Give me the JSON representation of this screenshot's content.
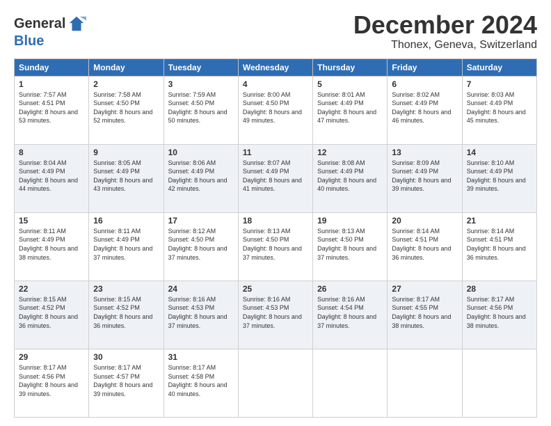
{
  "logo": {
    "line1": "General",
    "line2": "Blue"
  },
  "title": "December 2024",
  "subtitle": "Thonex, Geneva, Switzerland",
  "days_header": [
    "Sunday",
    "Monday",
    "Tuesday",
    "Wednesday",
    "Thursday",
    "Friday",
    "Saturday"
  ],
  "weeks": [
    [
      {
        "day": "1",
        "sunrise": "7:57 AM",
        "sunset": "4:51 PM",
        "daylight": "8 hours and 53 minutes."
      },
      {
        "day": "2",
        "sunrise": "7:58 AM",
        "sunset": "4:50 PM",
        "daylight": "8 hours and 52 minutes."
      },
      {
        "day": "3",
        "sunrise": "7:59 AM",
        "sunset": "4:50 PM",
        "daylight": "8 hours and 50 minutes."
      },
      {
        "day": "4",
        "sunrise": "8:00 AM",
        "sunset": "4:50 PM",
        "daylight": "8 hours and 49 minutes."
      },
      {
        "day": "5",
        "sunrise": "8:01 AM",
        "sunset": "4:49 PM",
        "daylight": "8 hours and 47 minutes."
      },
      {
        "day": "6",
        "sunrise": "8:02 AM",
        "sunset": "4:49 PM",
        "daylight": "8 hours and 46 minutes."
      },
      {
        "day": "7",
        "sunrise": "8:03 AM",
        "sunset": "4:49 PM",
        "daylight": "8 hours and 45 minutes."
      }
    ],
    [
      {
        "day": "8",
        "sunrise": "8:04 AM",
        "sunset": "4:49 PM",
        "daylight": "8 hours and 44 minutes."
      },
      {
        "day": "9",
        "sunrise": "8:05 AM",
        "sunset": "4:49 PM",
        "daylight": "8 hours and 43 minutes."
      },
      {
        "day": "10",
        "sunrise": "8:06 AM",
        "sunset": "4:49 PM",
        "daylight": "8 hours and 42 minutes."
      },
      {
        "day": "11",
        "sunrise": "8:07 AM",
        "sunset": "4:49 PM",
        "daylight": "8 hours and 41 minutes."
      },
      {
        "day": "12",
        "sunrise": "8:08 AM",
        "sunset": "4:49 PM",
        "daylight": "8 hours and 40 minutes."
      },
      {
        "day": "13",
        "sunrise": "8:09 AM",
        "sunset": "4:49 PM",
        "daylight": "8 hours and 39 minutes."
      },
      {
        "day": "14",
        "sunrise": "8:10 AM",
        "sunset": "4:49 PM",
        "daylight": "8 hours and 39 minutes."
      }
    ],
    [
      {
        "day": "15",
        "sunrise": "8:11 AM",
        "sunset": "4:49 PM",
        "daylight": "8 hours and 38 minutes."
      },
      {
        "day": "16",
        "sunrise": "8:11 AM",
        "sunset": "4:49 PM",
        "daylight": "8 hours and 37 minutes."
      },
      {
        "day": "17",
        "sunrise": "8:12 AM",
        "sunset": "4:50 PM",
        "daylight": "8 hours and 37 minutes."
      },
      {
        "day": "18",
        "sunrise": "8:13 AM",
        "sunset": "4:50 PM",
        "daylight": "8 hours and 37 minutes."
      },
      {
        "day": "19",
        "sunrise": "8:13 AM",
        "sunset": "4:50 PM",
        "daylight": "8 hours and 37 minutes."
      },
      {
        "day": "20",
        "sunrise": "8:14 AM",
        "sunset": "4:51 PM",
        "daylight": "8 hours and 36 minutes."
      },
      {
        "day": "21",
        "sunrise": "8:14 AM",
        "sunset": "4:51 PM",
        "daylight": "8 hours and 36 minutes."
      }
    ],
    [
      {
        "day": "22",
        "sunrise": "8:15 AM",
        "sunset": "4:52 PM",
        "daylight": "8 hours and 36 minutes."
      },
      {
        "day": "23",
        "sunrise": "8:15 AM",
        "sunset": "4:52 PM",
        "daylight": "8 hours and 36 minutes."
      },
      {
        "day": "24",
        "sunrise": "8:16 AM",
        "sunset": "4:53 PM",
        "daylight": "8 hours and 37 minutes."
      },
      {
        "day": "25",
        "sunrise": "8:16 AM",
        "sunset": "4:53 PM",
        "daylight": "8 hours and 37 minutes."
      },
      {
        "day": "26",
        "sunrise": "8:16 AM",
        "sunset": "4:54 PM",
        "daylight": "8 hours and 37 minutes."
      },
      {
        "day": "27",
        "sunrise": "8:17 AM",
        "sunset": "4:55 PM",
        "daylight": "8 hours and 38 minutes."
      },
      {
        "day": "28",
        "sunrise": "8:17 AM",
        "sunset": "4:56 PM",
        "daylight": "8 hours and 38 minutes."
      }
    ],
    [
      {
        "day": "29",
        "sunrise": "8:17 AM",
        "sunset": "4:56 PM",
        "daylight": "8 hours and 39 minutes."
      },
      {
        "day": "30",
        "sunrise": "8:17 AM",
        "sunset": "4:57 PM",
        "daylight": "8 hours and 39 minutes."
      },
      {
        "day": "31",
        "sunrise": "8:17 AM",
        "sunset": "4:58 PM",
        "daylight": "8 hours and 40 minutes."
      },
      null,
      null,
      null,
      null
    ]
  ]
}
